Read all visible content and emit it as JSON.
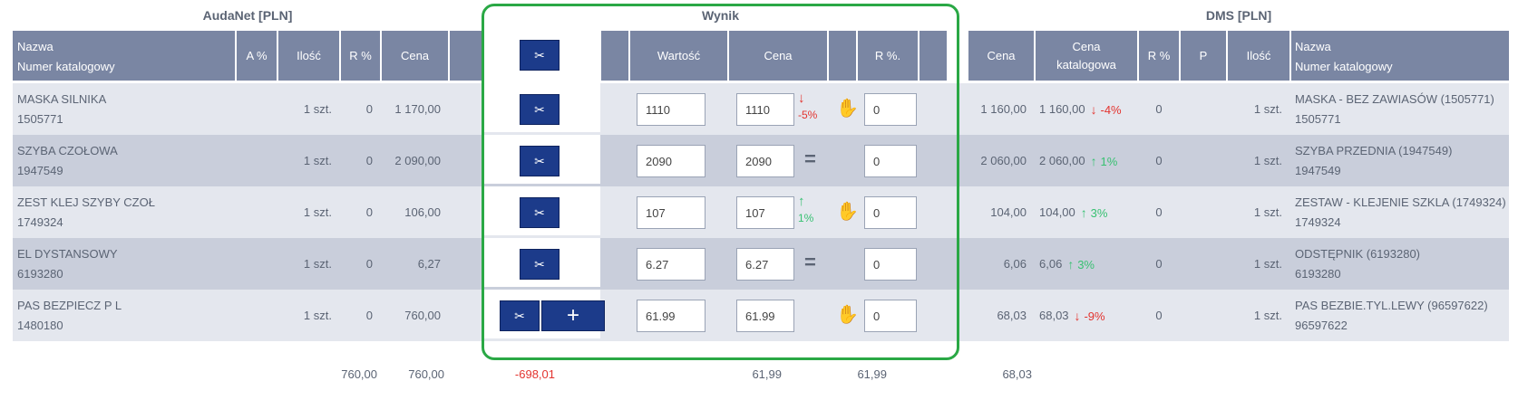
{
  "sections": {
    "left_title": "AudaNet [PLN]",
    "middle_title": "Wynik",
    "right_title": "DMS [PLN]"
  },
  "headers": {
    "left": {
      "name_line1": "Nazwa",
      "name_line2": "Numer katalogowy",
      "a_pct": "A %",
      "qty": "Ilość",
      "r_pct": "R %",
      "price": "Cena"
    },
    "middle": {
      "value": "Wartość",
      "price": "Cena",
      "r_pct": "R %."
    },
    "right": {
      "price": "Cena",
      "cat_price_line1": "Cena",
      "cat_price_line2": "katalogowa",
      "r_pct": "R %",
      "p": "P",
      "qty": "Ilość",
      "name_line1": "Nazwa",
      "name_line2": "Numer katalogowy"
    }
  },
  "rows": [
    {
      "left_name": "MASKA SILNIKA",
      "left_num": "1505771",
      "left_qty": "1 szt.",
      "left_r": "0",
      "left_price": "1 170,00",
      "value": "1110",
      "price": "1110",
      "price_trend": "down",
      "price_trend_text": "-5%",
      "hand": true,
      "r_pct": "0",
      "right_price": "1 160,00",
      "cat_price": "1 160,00",
      "cat_trend": "down",
      "cat_trend_text": "-4%",
      "right_r": "0",
      "right_qty": "1 szt.",
      "right_name": "MASKA - BEZ ZAWIASÓW (1505771)",
      "right_num": "1505771"
    },
    {
      "left_name": "SZYBA CZOŁOWA",
      "left_num": "1947549",
      "left_qty": "1 szt.",
      "left_r": "0",
      "left_price": "2 090,00",
      "value": "2090",
      "price": "2090",
      "price_trend": "equal",
      "price_trend_text": "=",
      "hand": false,
      "r_pct": "0",
      "right_price": "2 060,00",
      "cat_price": "2 060,00",
      "cat_trend": "up",
      "cat_trend_text": "1%",
      "right_r": "0",
      "right_qty": "1 szt.",
      "right_name": "SZYBA PRZEDNIA (1947549)",
      "right_num": "1947549"
    },
    {
      "left_name": "ZEST KLEJ SZYBY CZOŁ",
      "left_num": "1749324",
      "left_qty": "1 szt.",
      "left_r": "0",
      "left_price": "106,00",
      "value": "107",
      "price": "107",
      "price_trend": "up",
      "price_trend_text": "1%",
      "hand": true,
      "r_pct": "0",
      "right_price": "104,00",
      "cat_price": "104,00",
      "cat_trend": "up",
      "cat_trend_text": "3%",
      "right_r": "0",
      "right_qty": "1 szt.",
      "right_name": "ZESTAW - KLEJENIE SZKLA (1749324)",
      "right_num": "1749324"
    },
    {
      "left_name": "EL DYSTANSOWY",
      "left_num": "6193280",
      "left_qty": "1 szt.",
      "left_r": "0",
      "left_price": "6,27",
      "value": "6.27",
      "price": "6.27",
      "price_trend": "equal",
      "price_trend_text": "=",
      "hand": false,
      "r_pct": "0",
      "right_price": "6,06",
      "cat_price": "6,06",
      "cat_trend": "up",
      "cat_trend_text": "3%",
      "right_r": "0",
      "right_qty": "1 szt.",
      "right_name": "ODSTĘPNIK (6193280)",
      "right_num": "6193280"
    },
    {
      "left_name": "PAS BEZPIECZ P L",
      "left_num": "1480180",
      "left_qty": "1 szt.",
      "left_r": "0",
      "left_price": "760,00",
      "value": "61.99",
      "price": "61.99",
      "price_trend": "none",
      "price_trend_text": "",
      "hand": true,
      "r_pct": "0",
      "right_price": "68,03",
      "cat_price": "68,03",
      "cat_trend": "down",
      "cat_trend_text": "-9%",
      "right_r": "0",
      "right_qty": "1 szt.",
      "right_name": "PAS BEZBIE.TYL.LEWY (96597622)",
      "right_num": "96597622"
    }
  ],
  "totals": {
    "left_r": "760,00",
    "left_price": "760,00",
    "diff": "-698,01",
    "mid_price": "61,99",
    "mid_r": "61,99",
    "right_price": "68,03"
  },
  "icons": {
    "scissors": "scissors-icon",
    "plus": "plus-icon",
    "hand": "hand-stop-icon",
    "arrow_down": "arrow-down-icon",
    "arrow_up": "arrow-up-icon",
    "equal": "equal-icon"
  },
  "colors": {
    "header_bg": "#7a86a3",
    "row_odd": "#e4e7ee",
    "row_even": "#c9cedb",
    "button_bg": "#1c3b8a",
    "frame": "#2aa845",
    "down": "#e3342f",
    "up": "#38c172",
    "diff": "#e3342f"
  }
}
